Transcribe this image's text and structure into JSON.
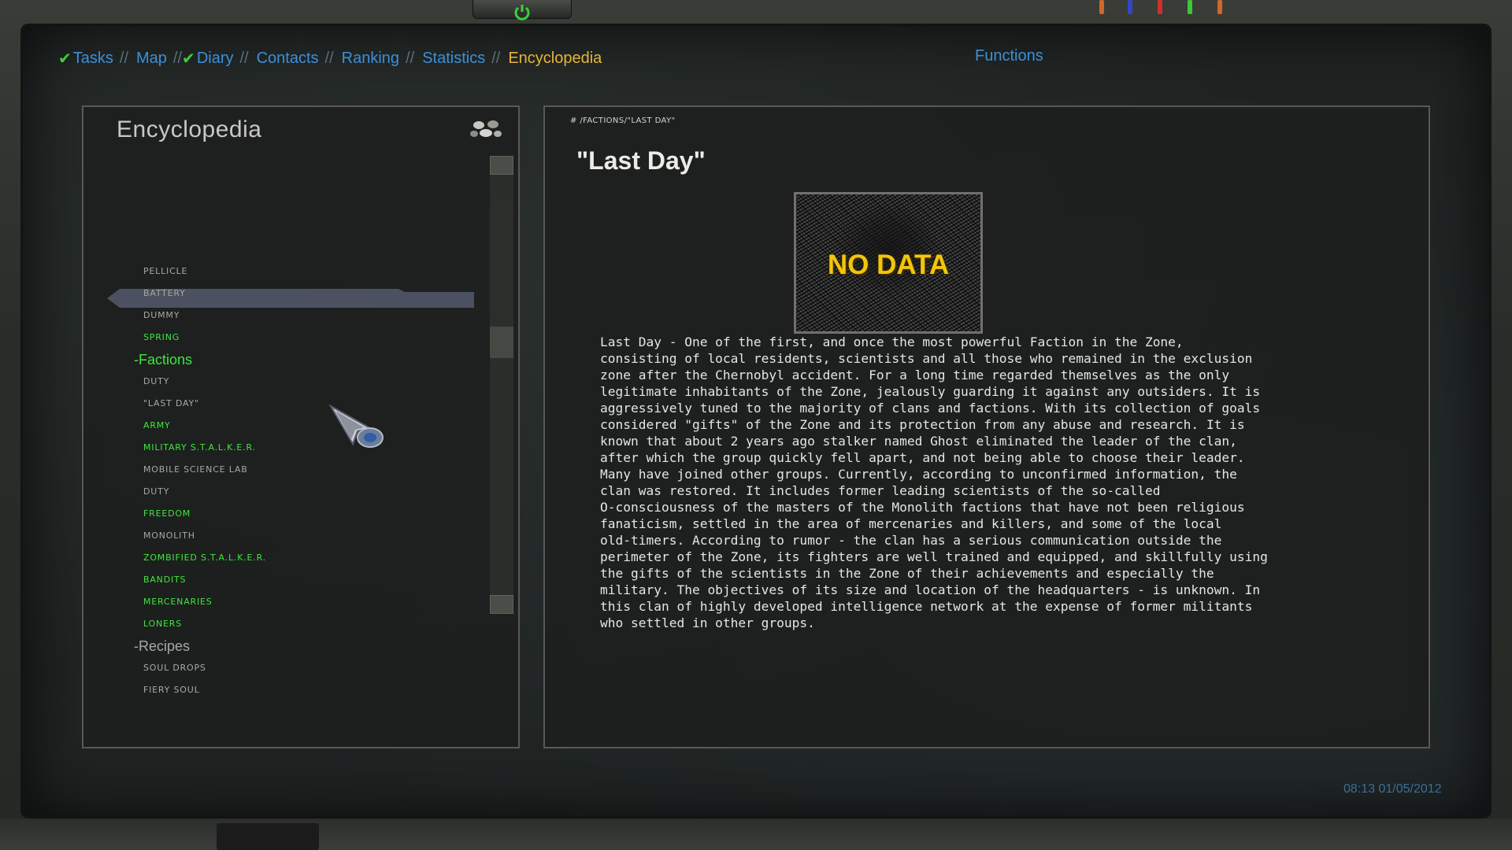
{
  "nav": {
    "items": [
      {
        "label": "Tasks",
        "checked": true,
        "active": false
      },
      {
        "label": "Map",
        "checked": false,
        "active": false
      },
      {
        "label": "Diary",
        "checked": true,
        "active": false
      },
      {
        "label": "Contacts",
        "checked": false,
        "active": false
      },
      {
        "label": "Ranking",
        "checked": false,
        "active": false
      },
      {
        "label": "Statistics",
        "checked": false,
        "active": false
      },
      {
        "label": "Encyclopedia",
        "checked": false,
        "active": true
      }
    ],
    "separator": "//",
    "functions_label": "Functions"
  },
  "left": {
    "title": "Encyclopedia",
    "tree": [
      {
        "type": "item",
        "label": "PELLICLE",
        "color": "grey"
      },
      {
        "type": "item",
        "label": "BATTERY",
        "color": "grey"
      },
      {
        "type": "item",
        "label": "DUMMY",
        "color": "grey"
      },
      {
        "type": "item",
        "label": "SPRING",
        "color": "green"
      },
      {
        "type": "category",
        "label": "-Factions",
        "color": "green"
      },
      {
        "type": "item",
        "label": "DUTY",
        "color": "grey"
      },
      {
        "type": "item",
        "label": "\"LAST DAY\"",
        "color": "grey",
        "selected": true
      },
      {
        "type": "item",
        "label": "ARMY",
        "color": "green"
      },
      {
        "type": "item",
        "label": "MILITARY S.T.A.L.K.E.R.",
        "color": "green"
      },
      {
        "type": "item",
        "label": "MOBILE SCIENCE LAB",
        "color": "grey"
      },
      {
        "type": "item",
        "label": "DUTY",
        "color": "grey"
      },
      {
        "type": "item",
        "label": "FREEDOM",
        "color": "green"
      },
      {
        "type": "item",
        "label": "MONOLITH",
        "color": "grey"
      },
      {
        "type": "item",
        "label": "ZOMBIFIED S.T.A.L.K.E.R.",
        "color": "green"
      },
      {
        "type": "item",
        "label": "BANDITS",
        "color": "green"
      },
      {
        "type": "item",
        "label": "MERCENARIES",
        "color": "green"
      },
      {
        "type": "item",
        "label": "LONERS",
        "color": "green"
      },
      {
        "type": "category",
        "label": "-Recipes",
        "color": "grey"
      },
      {
        "type": "item",
        "label": "SOUL DROPS",
        "color": "grey"
      },
      {
        "type": "item",
        "label": "FIERY SOUL",
        "color": "grey"
      }
    ]
  },
  "article": {
    "breadcrumb": "# /FACTIONS/\"LAST DAY\"",
    "title": "\"Last Day\"",
    "image_label": "NO DATA",
    "body_lines": [
      "Last Day - One of the first, and once the most powerful Faction in the Zone,",
      "consisting of local residents, scientists and all those who remained in the exclusion",
      "zone after the Chernobyl accident. For a long time regarded themselves as the only",
      "legitimate inhabitants of the Zone, jealously guarding it against any outsiders. It is",
      "aggressively tuned to the majority of clans and factions. With its collection of goals",
      "considered \"gifts\" of the Zone and its protection from any abuse and research. It is",
      "known that about 2 years ago stalker named Ghost eliminated the leader of the clan,",
      "after which the group quickly fell apart, and not being able to choose their leader.",
      "Many have joined other groups. Currently, according to unconfirmed information, the",
      "clan was restored. It includes former leading scientists of the so-called",
      "O-consciousness of the masters of the Monolith factions that have not been religious",
      "fanaticism, settled in the area of mercenaries and killers, and some of the local",
      "old-timers. According to rumor - the clan has a serious communication outside the",
      "perimeter of the Zone, its fighters are well trained and equipped, and skillfully using",
      "the gifts of the scientists in the Zone of their achievements and especially the",
      "military. The objectives of its size and location of the headquarters - is unknown. In",
      "this clan of highly developed intelligence network at the expense of former militants",
      "who settled in other groups."
    ]
  },
  "status": {
    "datetime": "08:13 01/05/2012"
  },
  "colors": {
    "nav_link": "#3d8fd9",
    "nav_active": "#e8b33a",
    "green_item": "#3ee63e",
    "grey_item": "#a6a9a2",
    "selection": "#4c5162",
    "nodata_text": "#f2c50f"
  }
}
